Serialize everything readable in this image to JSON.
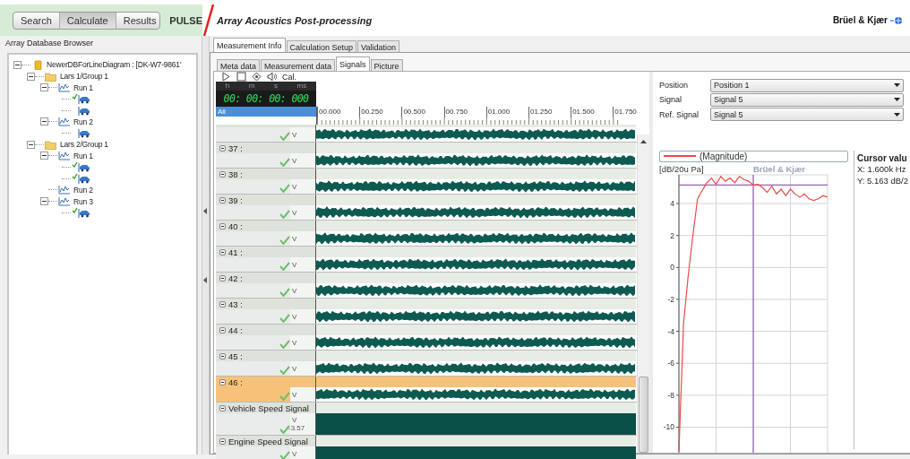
{
  "header": {
    "buttons": [
      {
        "label": "Search",
        "selected": false
      },
      {
        "label": "Calculate",
        "selected": true
      },
      {
        "label": "Results",
        "selected": false
      }
    ],
    "product": "PULSE",
    "title": "Array Acoustics Post-processing",
    "brand": "Brüel & Kjær"
  },
  "browser": {
    "title": "Array Database Browser",
    "tree": [
      {
        "kind": "database",
        "label": "NewerDBForLineDiagram : [DK-W7-9861'",
        "expanded": true,
        "children": [
          {
            "kind": "folder",
            "label": "Lars 1/Group 1",
            "expanded": true,
            "children": [
              {
                "kind": "run",
                "label": "Run 1",
                "expanded": true,
                "children": [
                  {
                    "kind": "measurement",
                    "checked": true
                  },
                  {
                    "kind": "measurement",
                    "checked": false
                  }
                ]
              },
              {
                "kind": "run",
                "label": "Run 2",
                "expanded": true,
                "children": [
                  {
                    "kind": "measurement",
                    "checked": false
                  }
                ]
              }
            ]
          },
          {
            "kind": "folder",
            "label": "Lars 2/Group 1",
            "expanded": true,
            "children": [
              {
                "kind": "run",
                "label": "Run 1",
                "expanded": true,
                "children": [
                  {
                    "kind": "measurement",
                    "checked": true
                  },
                  {
                    "kind": "measurement",
                    "checked": true
                  }
                ]
              },
              {
                "kind": "run",
                "label": "Run 2"
              },
              {
                "kind": "run",
                "label": "Run 3",
                "expanded": true,
                "children": [
                  {
                    "kind": "measurement",
                    "checked": true
                  }
                ]
              }
            ]
          }
        ]
      }
    ]
  },
  "tabs": [
    {
      "label": "Measurement Info",
      "selected": true
    },
    {
      "label": "Calculation Setup",
      "selected": false
    },
    {
      "label": "Validation",
      "selected": false
    }
  ],
  "subtabs": [
    {
      "label": "Meta data",
      "selected": false
    },
    {
      "label": "Measurement data",
      "selected": false
    },
    {
      "label": "Signals",
      "selected": true
    },
    {
      "label": "Picture",
      "selected": false
    }
  ],
  "signals": {
    "toolbar": {
      "calibrate": "Cal."
    },
    "timer": {
      "units": [
        "h",
        "m",
        "s",
        "ms"
      ],
      "value": "00: 00: 00: 000"
    },
    "filter": "All",
    "ruler": [
      "00.000",
      "00.250",
      "00.500",
      "00.750",
      "01.000",
      "01.250",
      "01.500",
      "01.750"
    ],
    "rows": [
      {
        "kind": "noise",
        "checked": true,
        "unit": "V",
        "selected": false
      },
      {
        "kind": "noise",
        "label": "37 :",
        "checked": true,
        "unit": "V",
        "selected": false
      },
      {
        "kind": "noise",
        "label": "38 :",
        "checked": true,
        "unit": "V",
        "selected": false
      },
      {
        "kind": "noise",
        "label": "39 :",
        "checked": true,
        "unit": "V",
        "selected": false
      },
      {
        "kind": "noise",
        "label": "40 :",
        "checked": true,
        "unit": "V",
        "selected": false
      },
      {
        "kind": "noise",
        "label": "41 :",
        "checked": true,
        "unit": "V",
        "selected": false
      },
      {
        "kind": "noise",
        "label": "42 :",
        "checked": true,
        "unit": "V",
        "selected": false
      },
      {
        "kind": "noise",
        "label": "43 :",
        "checked": true,
        "unit": "V",
        "selected": false
      },
      {
        "kind": "noise",
        "label": "44 :",
        "checked": true,
        "unit": "V",
        "selected": false
      },
      {
        "kind": "noise",
        "label": "45 :",
        "checked": true,
        "unit": "V",
        "selected": false
      },
      {
        "kind": "noise",
        "label": "46 :",
        "checked": true,
        "unit": "V",
        "selected": true
      },
      {
        "kind": "solid",
        "label": "Vehicle  Speed Signal",
        "checked": true,
        "unit": "V",
        "reading": "-3.57",
        "selected": false
      },
      {
        "kind": "solid",
        "label": "Engine  Speed Signal",
        "checked": true,
        "unit": "V",
        "selected": false
      }
    ]
  },
  "selectors": [
    {
      "label": "Position",
      "value": "Position 1"
    },
    {
      "label": "Signal",
      "value": "Signal 5"
    },
    {
      "label": "Ref. Signal",
      "value": "Signal 5"
    }
  ],
  "chart": {
    "watermark": "Brüel & Kjær",
    "chart_data": {
      "type": "line",
      "ylabel": "[dB/20u Pa]",
      "ylim": [
        -11.6,
        5.8
      ],
      "grid": true,
      "ref_lines": [
        {
          "axis": "y",
          "value": 5.163
        }
      ],
      "yticks": [
        4,
        2,
        0,
        -2,
        -4,
        -6,
        -8,
        -10
      ],
      "series": [
        {
          "name": "(Magnitude)",
          "color": "#f04848",
          "values": [
            -11.5,
            -3.5,
            -0.5,
            2,
            4.3,
            4.8,
            5.3,
            5.6,
            5.2,
            5.7,
            5.4,
            5.6,
            5.3,
            5.7,
            5.5,
            5.4,
            5.16,
            5.2,
            5.0,
            4.7,
            5.1,
            4.6,
            4.9,
            4.5,
            4.9,
            4.6,
            4.4,
            4.6,
            4.3,
            4.2,
            4.3,
            4.5,
            4.4
          ]
        }
      ]
    }
  },
  "cursor": {
    "title": "Cursor valu",
    "x": "X: 1.600k Hz",
    "y": "Y: 5.163 dB/2"
  }
}
